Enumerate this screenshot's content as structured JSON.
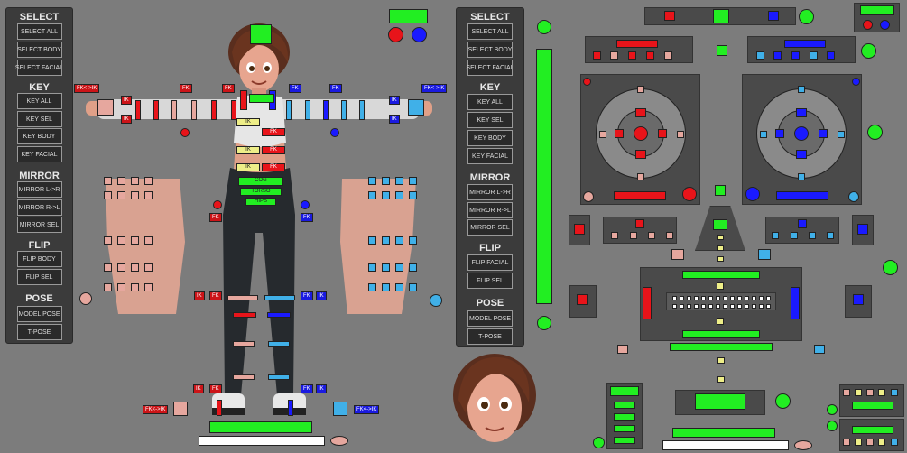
{
  "left_panel": {
    "select_header": "SELECT",
    "select_all": "SELECT ALL",
    "select_body": "SELECT BODY",
    "select_facial": "SELECT FACIAL",
    "key_header": "KEY",
    "key_all": "KEY ALL",
    "key_sel": "KEY SEL",
    "key_body": "KEY BODY",
    "key_facial": "KEY FACIAL",
    "mirror_header": "MIRROR",
    "mirror_lr": "MIRROR L->R",
    "mirror_rl": "MIRROR R->L",
    "mirror_sel": "MIRROR SEL",
    "flip_header": "FLIP",
    "flip_body": "FLIP BODY",
    "flip_sel": "FLIP SEL",
    "pose_header": "POSE",
    "model_pose": "MODEL POSE",
    "t_pose": "T-POSE"
  },
  "right_panel": {
    "select_header": "SELECT",
    "select_all": "SELECT ALL",
    "select_body": "SELECT BODY",
    "select_facial": "SELECT FACIAL",
    "key_header": "KEY",
    "key_all": "KEY ALL",
    "key_sel": "KEY SEL",
    "key_body": "KEY BODY",
    "key_facial": "KEY FACIAL",
    "mirror_header": "MIRROR",
    "mirror_lr": "MIRROR L->R",
    "mirror_rl": "MIRROR R->L",
    "mirror_sel": "MIRROR SEL",
    "flip_header": "FLIP",
    "flip_facial": "FLIP FACIAL",
    "flip_sel": "FLIP SEL",
    "pose_header": "POSE",
    "model_pose": "MODEL POSE",
    "t_pose": "T-POSE"
  },
  "body_picker": {
    "fk_ik_tag": "FK<->IK",
    "fk_tag": "FK",
    "ik_tag": "IK",
    "cog_label": "COG",
    "torso_label": "TORSO",
    "hips_label": "HIPS"
  },
  "colors": {
    "left_side": "#e8141a",
    "right_side": "#1a1aff",
    "center": "#22ee22",
    "ik": "#eeee88",
    "background": "#7c7c7c",
    "panel": "#3b3b3b"
  }
}
